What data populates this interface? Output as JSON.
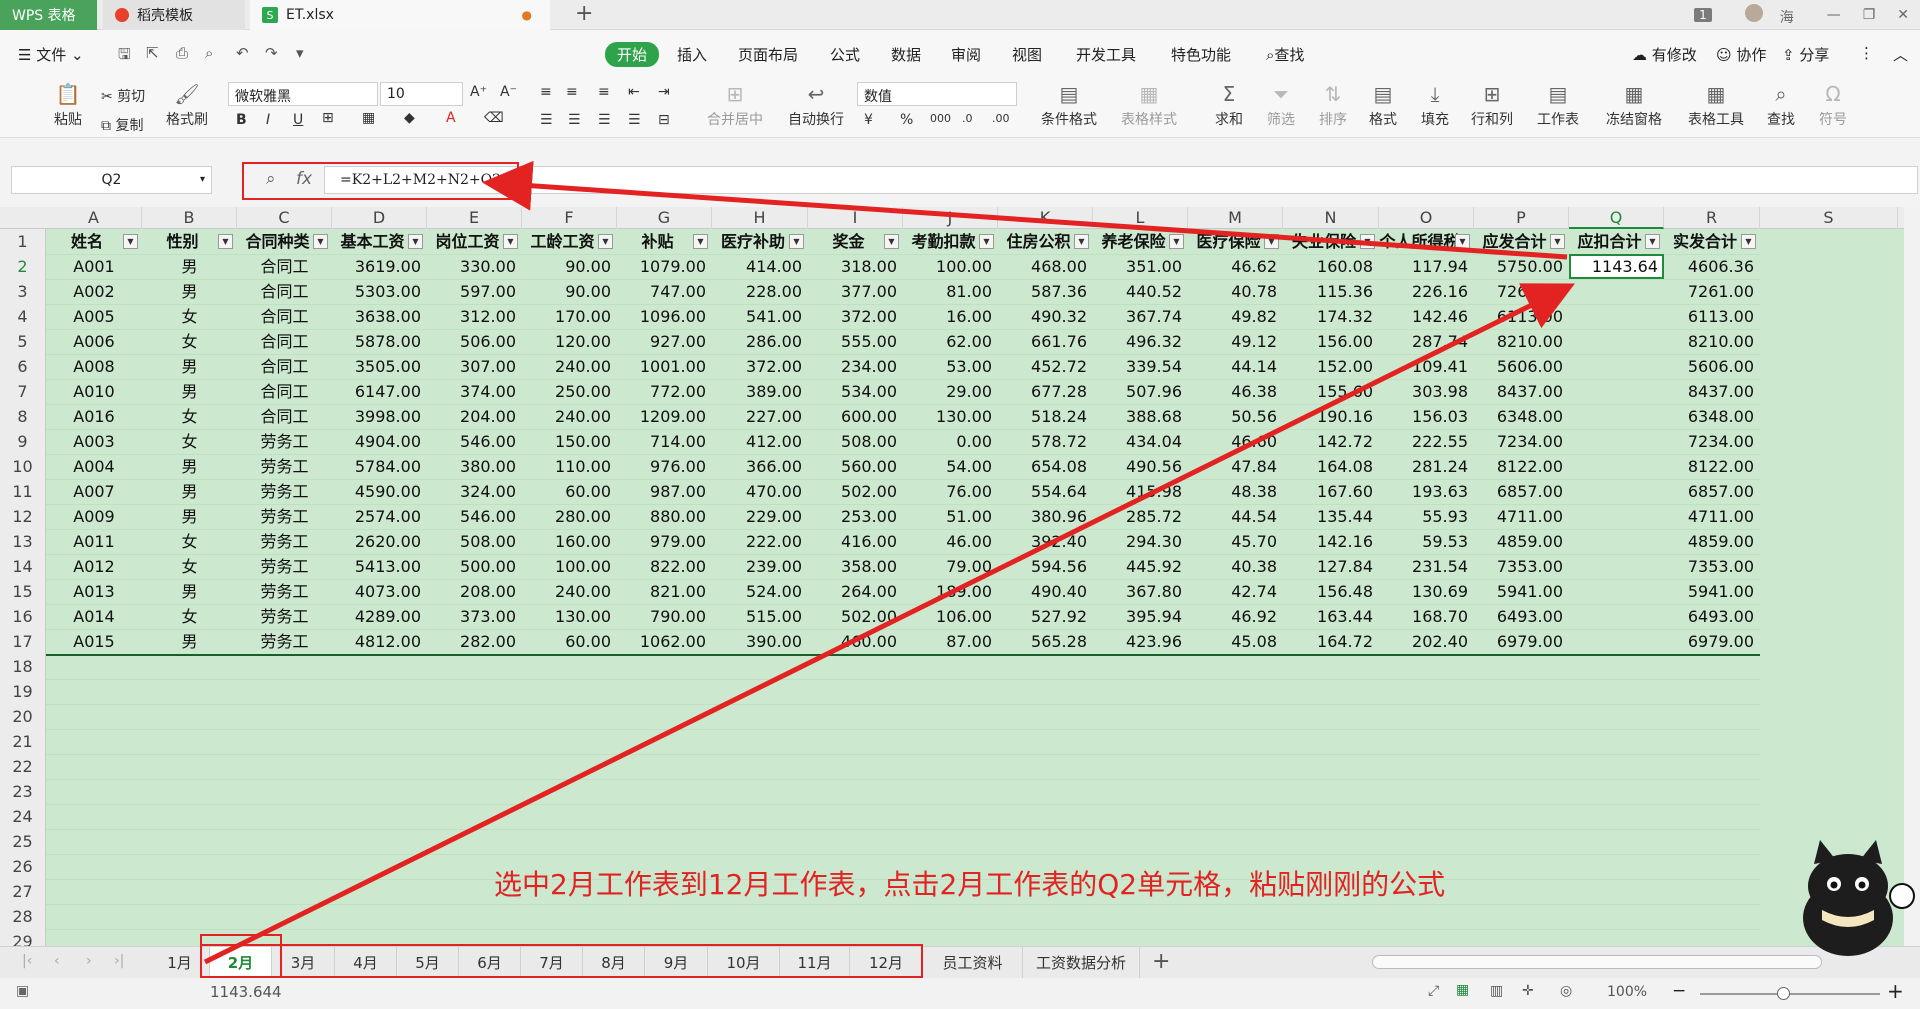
{
  "titlebar": {
    "app_tab": "WPS 表格",
    "template_tab": "稻壳模板",
    "file_tab": "ET.xlsx",
    "user_name": "海",
    "badge": "1"
  },
  "menu": {
    "file": "文件",
    "tabs": [
      "开始",
      "插入",
      "页面布局",
      "公式",
      "数据",
      "审阅",
      "视图",
      "开发工具",
      "特色功能"
    ],
    "search": "查找",
    "right": [
      "有修改",
      "协作",
      "分享"
    ]
  },
  "ribbon": {
    "paste": "粘贴",
    "cut": "剪切",
    "copy": "复制",
    "format_painter": "格式刷",
    "font_name": "微软雅黑",
    "font_size": "10",
    "merge": "合并居中",
    "wrap": "自动换行",
    "number_format": "数值",
    "conditional": "条件格式",
    "table_style": "表格样式",
    "sum": "求和",
    "filter": "筛选",
    "sort": "排序",
    "format": "格式",
    "fill": "填充",
    "rowcol": "行和列",
    "worksheet": "工作表",
    "freeze": "冻结窗格",
    "table_tools": "表格工具",
    "find": "查找",
    "symbol": "符号"
  },
  "formula_bar": {
    "name_box": "Q2",
    "fx": "fx",
    "formula": "=K2+L2+M2+N2+O2"
  },
  "columns": [
    "A",
    "B",
    "C",
    "D",
    "E",
    "F",
    "G",
    "H",
    "I",
    "J",
    "K",
    "L",
    "M",
    "N",
    "O",
    "P",
    "Q",
    "R",
    "S"
  ],
  "row_numbers": [
    "1",
    "2",
    "3",
    "4",
    "5",
    "6",
    "7",
    "8",
    "9",
    "10",
    "11",
    "12",
    "13",
    "14",
    "15",
    "16",
    "17",
    "18",
    "19",
    "20",
    "21",
    "22",
    "23",
    "24",
    "25",
    "26",
    "27",
    "28",
    "29"
  ],
  "headers": [
    "姓名",
    "性别",
    "合同种类",
    "基本工资",
    "岗位工资",
    "工龄工资",
    "补贴",
    "医疗补助",
    "奖金",
    "考勤扣款",
    "住房公积",
    "养老保险",
    "医疗保险",
    "失业保险",
    "个人所得税",
    "应发合计",
    "应扣合计",
    "实发合计"
  ],
  "rows": [
    [
      "A001",
      "男",
      "合同工",
      "3619.00",
      "330.00",
      "90.00",
      "1079.00",
      "414.00",
      "318.00",
      "100.00",
      "468.00",
      "351.00",
      "46.62",
      "160.08",
      "117.94",
      "5750.00",
      "1143.64",
      "4606.36"
    ],
    [
      "A002",
      "男",
      "合同工",
      "5303.00",
      "597.00",
      "90.00",
      "747.00",
      "228.00",
      "377.00",
      "81.00",
      "587.36",
      "440.52",
      "40.78",
      "115.36",
      "226.16",
      "7261.00",
      "",
      "7261.00"
    ],
    [
      "A005",
      "女",
      "合同工",
      "3638.00",
      "312.00",
      "170.00",
      "1096.00",
      "541.00",
      "372.00",
      "16.00",
      "490.32",
      "367.74",
      "49.82",
      "174.32",
      "142.46",
      "6113.00",
      "",
      "6113.00"
    ],
    [
      "A006",
      "女",
      "合同工",
      "5878.00",
      "506.00",
      "120.00",
      "927.00",
      "286.00",
      "555.00",
      "62.00",
      "661.76",
      "496.32",
      "49.12",
      "156.00",
      "287.74",
      "8210.00",
      "",
      "8210.00"
    ],
    [
      "A008",
      "男",
      "合同工",
      "3505.00",
      "307.00",
      "240.00",
      "1001.00",
      "372.00",
      "234.00",
      "53.00",
      "452.72",
      "339.54",
      "44.14",
      "152.00",
      "109.41",
      "5606.00",
      "",
      "5606.00"
    ],
    [
      "A010",
      "男",
      "合同工",
      "6147.00",
      "374.00",
      "250.00",
      "772.00",
      "389.00",
      "534.00",
      "29.00",
      "677.28",
      "507.96",
      "46.38",
      "155.60",
      "303.98",
      "8437.00",
      "",
      "8437.00"
    ],
    [
      "A016",
      "女",
      "合同工",
      "3998.00",
      "204.00",
      "240.00",
      "1209.00",
      "227.00",
      "600.00",
      "130.00",
      "518.24",
      "388.68",
      "50.56",
      "190.16",
      "156.03",
      "6348.00",
      "",
      "6348.00"
    ],
    [
      "A003",
      "女",
      "劳务工",
      "4904.00",
      "546.00",
      "150.00",
      "714.00",
      "412.00",
      "508.00",
      "0.00",
      "578.72",
      "434.04",
      "46.60",
      "142.72",
      "222.55",
      "7234.00",
      "",
      "7234.00"
    ],
    [
      "A004",
      "男",
      "劳务工",
      "5784.00",
      "380.00",
      "110.00",
      "976.00",
      "366.00",
      "560.00",
      "54.00",
      "654.08",
      "490.56",
      "47.84",
      "164.08",
      "281.24",
      "8122.00",
      "",
      "8122.00"
    ],
    [
      "A007",
      "男",
      "劳务工",
      "4590.00",
      "324.00",
      "60.00",
      "987.00",
      "470.00",
      "502.00",
      "76.00",
      "554.64",
      "415.98",
      "48.38",
      "167.60",
      "193.63",
      "6857.00",
      "",
      "6857.00"
    ],
    [
      "A009",
      "男",
      "劳务工",
      "2574.00",
      "546.00",
      "280.00",
      "880.00",
      "229.00",
      "253.00",
      "51.00",
      "380.96",
      "285.72",
      "44.54",
      "135.44",
      "55.93",
      "4711.00",
      "",
      "4711.00"
    ],
    [
      "A011",
      "女",
      "劳务工",
      "2620.00",
      "508.00",
      "160.00",
      "979.00",
      "222.00",
      "416.00",
      "46.00",
      "392.40",
      "294.30",
      "45.70",
      "142.16",
      "59.53",
      "4859.00",
      "",
      "4859.00"
    ],
    [
      "A012",
      "女",
      "劳务工",
      "5413.00",
      "500.00",
      "100.00",
      "822.00",
      "239.00",
      "358.00",
      "79.00",
      "594.56",
      "445.92",
      "40.38",
      "127.84",
      "231.54",
      "7353.00",
      "",
      "7353.00"
    ],
    [
      "A013",
      "男",
      "劳务工",
      "4073.00",
      "208.00",
      "240.00",
      "821.00",
      "524.00",
      "264.00",
      "189.00",
      "490.40",
      "367.80",
      "42.74",
      "156.48",
      "130.69",
      "5941.00",
      "",
      "5941.00"
    ],
    [
      "A014",
      "女",
      "劳务工",
      "4289.00",
      "373.00",
      "130.00",
      "790.00",
      "515.00",
      "502.00",
      "106.00",
      "527.92",
      "395.94",
      "46.92",
      "163.44",
      "168.70",
      "6493.00",
      "",
      "6493.00"
    ],
    [
      "A015",
      "男",
      "劳务工",
      "4812.00",
      "282.00",
      "60.00",
      "1062.00",
      "390.00",
      "460.00",
      "87.00",
      "565.28",
      "423.96",
      "45.08",
      "164.72",
      "202.40",
      "6979.00",
      "",
      "6979.00"
    ]
  ],
  "annotation": "选中2月工作表到12月工作表，点击2月工作表的Q2单元格，粘贴刚刚的公式",
  "sheets": [
    "1月",
    "2月",
    "3月",
    "4月",
    "5月",
    "6月",
    "7月",
    "8月",
    "9月",
    "10月",
    "11月",
    "12月",
    "员工资料",
    "工资数据分析"
  ],
  "status": {
    "sum_value": "1143.644",
    "zoom": "100%"
  },
  "colors": {
    "accent_green": "#2fa34b",
    "grid_fill": "#cce8cf",
    "annotation_red": "#e32222"
  }
}
